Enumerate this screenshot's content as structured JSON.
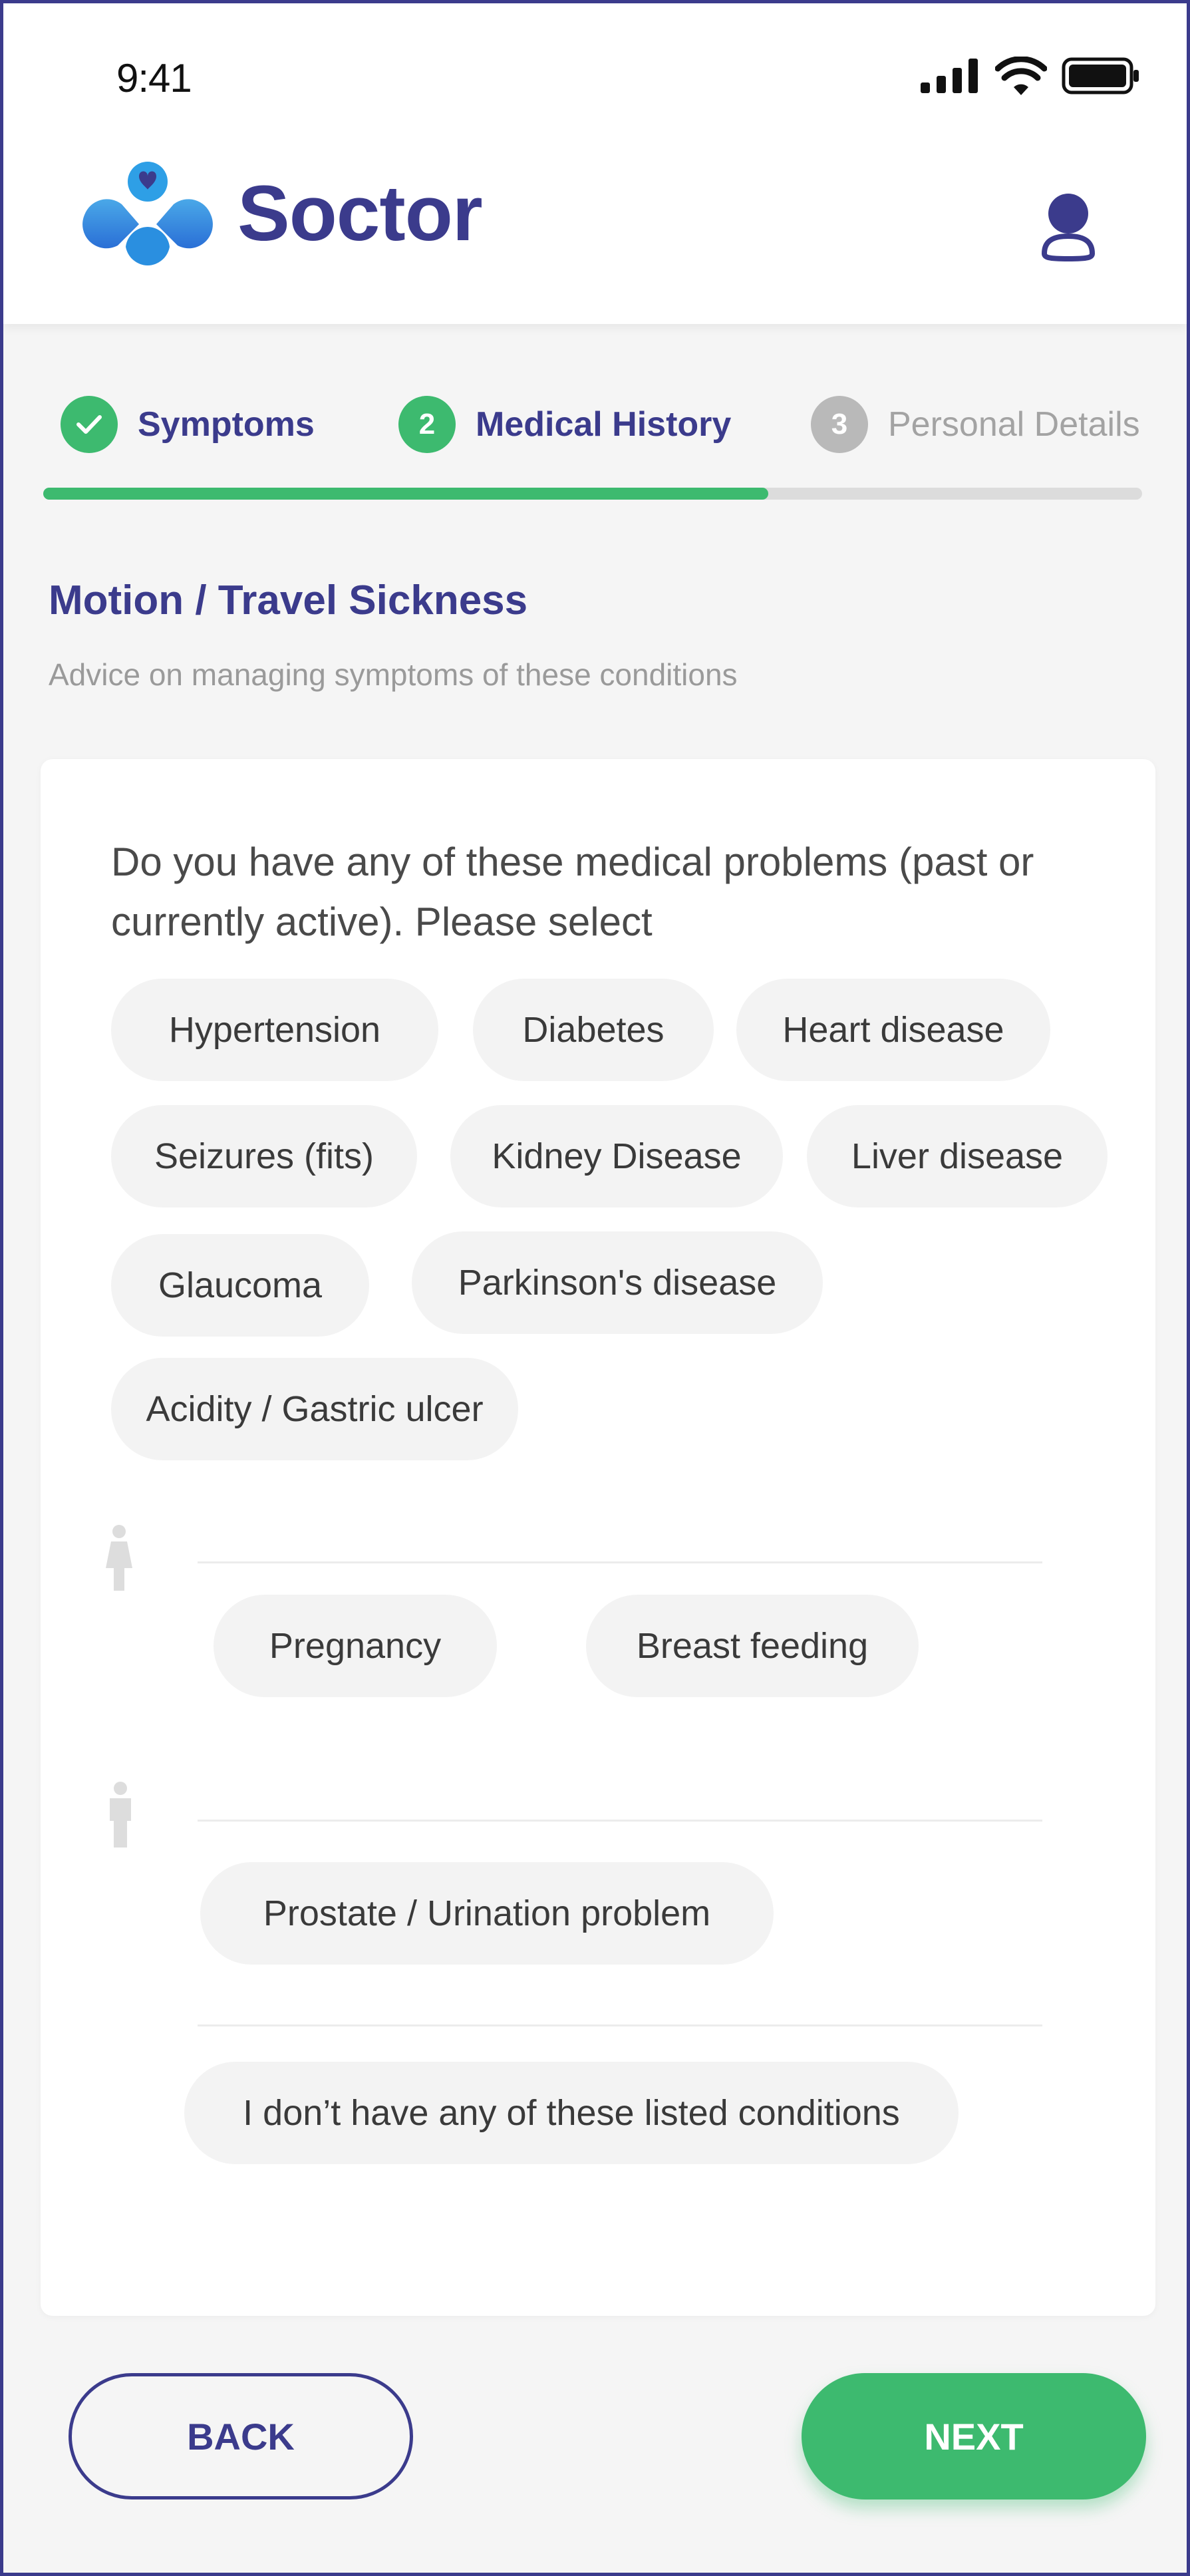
{
  "status_bar": {
    "time": "9:41"
  },
  "header": {
    "brand": "Soctor"
  },
  "stepper": {
    "steps": [
      {
        "number": "✓",
        "label": "Symptoms",
        "state": "done"
      },
      {
        "number": "2",
        "label": "Medical History",
        "state": "active"
      },
      {
        "number": "3",
        "label": "Personal Details",
        "state": "inactive"
      }
    ],
    "progress_fraction": 0.66
  },
  "section": {
    "title": "Motion / Travel Sickness",
    "subtitle": "Advice on managing symptoms of these conditions"
  },
  "question": "Do you have any of these medical problems (past or currently active). Please select",
  "conditions": [
    "Hypertension",
    "Diabetes",
    "Heart disease",
    "Seizures (fits)",
    "Kidney Disease",
    "Liver disease",
    "Glaucoma",
    "Parkinson's disease",
    "Acidity / Gastric ulcer"
  ],
  "female_conditions": [
    "Pregnancy",
    "Breast feeding"
  ],
  "male_conditions": [
    "Prostate / Urination problem"
  ],
  "none_option": "I don’t have any of these listed conditions",
  "buttons": {
    "back": "BACK",
    "next": "NEXT"
  },
  "colors": {
    "brand": "#3b3b8c",
    "accent": "#3dba6f",
    "chip_bg": "#f3f3f3"
  },
  "icons": [
    "signal-icon",
    "wifi-icon",
    "battery-icon",
    "heart-logo-icon",
    "user-icon",
    "check-icon",
    "female-icon",
    "male-icon"
  ]
}
